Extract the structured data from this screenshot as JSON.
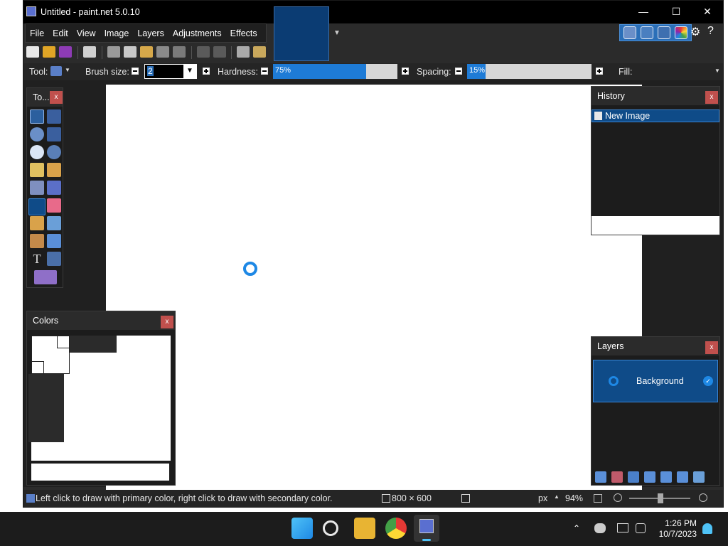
{
  "window": {
    "title": "Untitled - paint.net 5.0.10",
    "controls": {
      "minimize": "—",
      "maximize": "☐",
      "close": "✕"
    }
  },
  "menu": {
    "items": [
      "File",
      "Edit",
      "View",
      "Image",
      "Layers",
      "Adjustments",
      "Effects"
    ]
  },
  "options": {
    "tool_label": "Tool:",
    "brush_size_label": "Brush size:",
    "brush_size_value": "2",
    "hardness_label": "Hardness:",
    "hardness_value": "75%",
    "hardness_fraction": 0.75,
    "spacing_label": "Spacing:",
    "spacing_value": "15%",
    "spacing_fraction": 0.15,
    "fill_label": "Fill:"
  },
  "panels": {
    "tools": {
      "title": "To...",
      "close": "x"
    },
    "colors": {
      "title": "Colors",
      "close": "x"
    },
    "history": {
      "title": "History",
      "close": "x",
      "items": [
        "New Image"
      ]
    },
    "layers": {
      "title": "Layers",
      "close": "x",
      "items": [
        "Background"
      ]
    }
  },
  "status": {
    "hint": "Left click to draw with primary color, right click to draw with secondary color.",
    "image_size": "800 × 600",
    "units": "px",
    "zoom": "94%"
  },
  "taskbar": {
    "time": "1:26 PM",
    "date": "10/7/2023"
  },
  "colors_theme": {
    "accent": "#1e7bd6",
    "selection": "#0f4b88",
    "close_button": "#c0504d",
    "background": "#2b2b2b"
  }
}
